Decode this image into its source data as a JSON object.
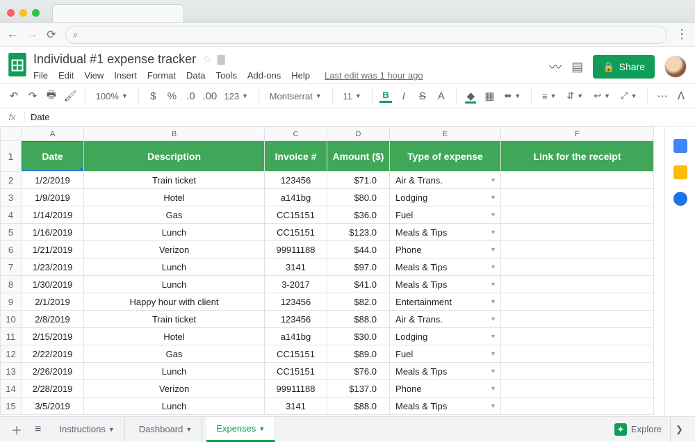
{
  "browser": {
    "search_icon": "⌕"
  },
  "doc": {
    "title": "Individual #1 expense tracker",
    "last_edit": "Last edit was 1 hour ago"
  },
  "menus": [
    "File",
    "Edit",
    "View",
    "Insert",
    "Format",
    "Data",
    "Tools",
    "Add-ons",
    "Help"
  ],
  "share_label": "Share",
  "toolbar": {
    "zoom": "100%",
    "currency": "$",
    "percent": "%",
    "dec_dec": ".0",
    "dec_inc": ".00",
    "numfmt": "123",
    "font": "Montserrat",
    "fsize": "11",
    "bold": "B",
    "italic": "I",
    "strike": "S",
    "textA": "A"
  },
  "namebox": "Date",
  "colLetters": [
    "A",
    "B",
    "C",
    "D",
    "E",
    "F"
  ],
  "headers": {
    "date": "Date",
    "desc": "Description",
    "inv": "Invoice #",
    "amt": "Amount ($)",
    "type": "Type of expense",
    "link": "Link for the receipt"
  },
  "rows": [
    {
      "n": "2",
      "date": "1/2/2019",
      "desc": "Train ticket",
      "inv": "123456",
      "amt": "$71.0",
      "type": "Air & Trans."
    },
    {
      "n": "3",
      "date": "1/9/2019",
      "desc": "Hotel",
      "inv": "a141bg",
      "amt": "$80.0",
      "type": "Lodging"
    },
    {
      "n": "4",
      "date": "1/14/2019",
      "desc": "Gas",
      "inv": "CC15151",
      "amt": "$36.0",
      "type": "Fuel"
    },
    {
      "n": "5",
      "date": "1/16/2019",
      "desc": "Lunch",
      "inv": "CC15151",
      "amt": "$123.0",
      "type": "Meals & Tips"
    },
    {
      "n": "6",
      "date": "1/21/2019",
      "desc": "Verizon",
      "inv": "99911188",
      "amt": "$44.0",
      "type": "Phone"
    },
    {
      "n": "7",
      "date": "1/23/2019",
      "desc": "Lunch",
      "inv": "3141",
      "amt": "$97.0",
      "type": "Meals & Tips"
    },
    {
      "n": "8",
      "date": "1/30/2019",
      "desc": "Lunch",
      "inv": "3-2017",
      "amt": "$41.0",
      "type": "Meals & Tips"
    },
    {
      "n": "9",
      "date": "2/1/2019",
      "desc": "Happy hour with client",
      "inv": "123456",
      "amt": "$82.0",
      "type": "Entertainment"
    },
    {
      "n": "10",
      "date": "2/8/2019",
      "desc": "Train ticket",
      "inv": "123456",
      "amt": "$88.0",
      "type": "Air & Trans."
    },
    {
      "n": "11",
      "date": "2/15/2019",
      "desc": "Hotel",
      "inv": "a141bg",
      "amt": "$30.0",
      "type": "Lodging"
    },
    {
      "n": "12",
      "date": "2/22/2019",
      "desc": "Gas",
      "inv": "CC15151",
      "amt": "$89.0",
      "type": "Fuel"
    },
    {
      "n": "13",
      "date": "2/26/2019",
      "desc": "Lunch",
      "inv": "CC15151",
      "amt": "$76.0",
      "type": "Meals & Tips"
    },
    {
      "n": "14",
      "date": "2/28/2019",
      "desc": "Verizon",
      "inv": "99911188",
      "amt": "$137.0",
      "type": "Phone"
    },
    {
      "n": "15",
      "date": "3/5/2019",
      "desc": "Lunch",
      "inv": "3141",
      "amt": "$88.0",
      "type": "Meals & Tips"
    }
  ],
  "tabs": {
    "instructions": "Instructions",
    "dashboard": "Dashboard",
    "expenses": "Expenses"
  },
  "explore": "Explore"
}
